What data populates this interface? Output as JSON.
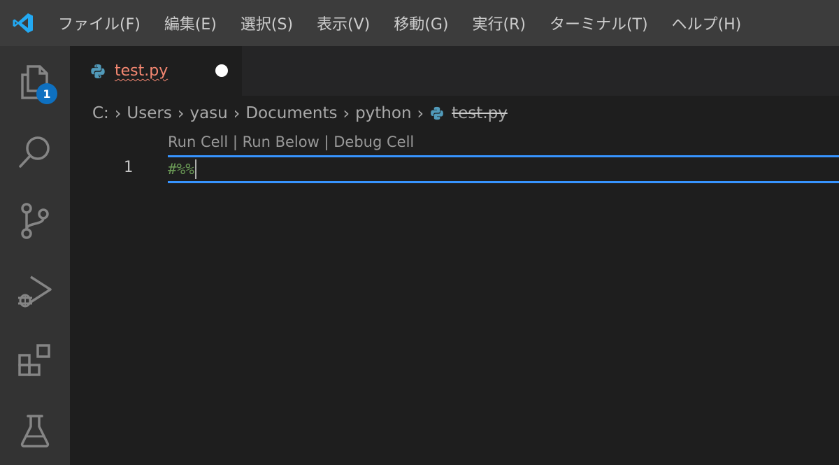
{
  "menubar": {
    "items": [
      "ファイル(F)",
      "編集(E)",
      "選択(S)",
      "表示(V)",
      "移動(G)",
      "実行(R)",
      "ターミナル(T)",
      "ヘルプ(H)"
    ]
  },
  "activitybar": {
    "items": [
      {
        "icon": "explorer-icon",
        "badge": "1"
      },
      {
        "icon": "search-icon"
      },
      {
        "icon": "source-control-icon"
      },
      {
        "icon": "run-debug-icon"
      },
      {
        "icon": "extensions-icon"
      },
      {
        "icon": "testing-icon"
      }
    ]
  },
  "tab": {
    "label": "test.py",
    "icon": "python-icon",
    "dirty": true,
    "label_color": "#f48771"
  },
  "breadcrumbs": {
    "parts": [
      "C:",
      "Users",
      "yasu",
      "Documents",
      "python"
    ],
    "file": "test.py"
  },
  "editor": {
    "codelens": {
      "run_cell": "Run Cell",
      "sep1": "|",
      "run_below": "Run Below",
      "sep2": "|",
      "debug_cell": "Debug Cell"
    },
    "line_number": "1",
    "code": "#%%",
    "cell_border_color": "#3794ff",
    "comment_color": "#6a9955"
  },
  "colors": {
    "menubar_bg": "#3c3c3c",
    "activitybar_bg": "#333333",
    "editor_bg": "#1e1e1e",
    "badge_bg": "#0e70c0"
  }
}
